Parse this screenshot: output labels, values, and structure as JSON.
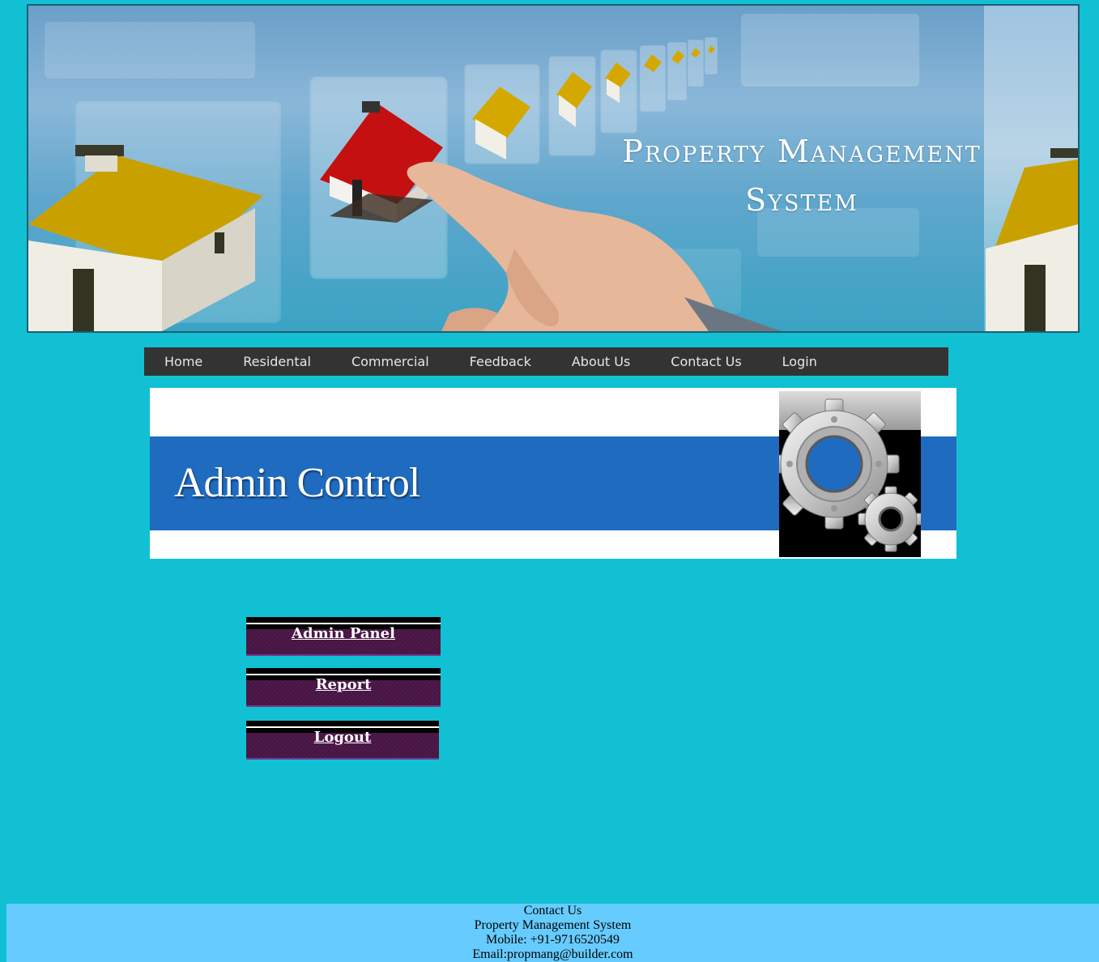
{
  "banner": {
    "title_line1": "Property Management",
    "title_line2": "System"
  },
  "nav": {
    "items": [
      "Home",
      "Residental",
      "Commercial",
      "Feedback",
      "About Us",
      "Contact Us",
      "Login"
    ]
  },
  "admin_header": {
    "title": "Admin Control"
  },
  "menu": {
    "admin_panel": "Admin Panel",
    "report": "Report",
    "logout": "Logout"
  },
  "footer": {
    "heading": "Contact Us",
    "company": "Property Management System",
    "mobile": "Mobile: +91-9716520549",
    "email": "Email:propmang@builder.com"
  },
  "colors": {
    "page_bg": "#12c0d4",
    "nav_bg": "#333333",
    "admin_band": "#1f6bbf",
    "button_bg": "#4a1747",
    "footer_bg": "#66ccff"
  }
}
